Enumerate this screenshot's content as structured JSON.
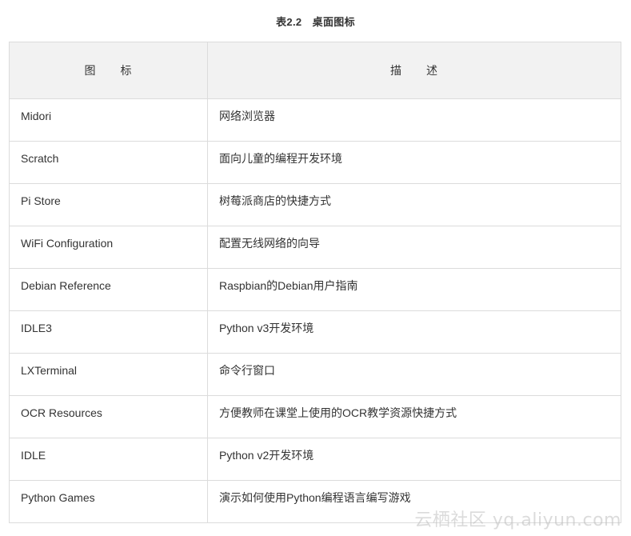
{
  "caption": "表2.2　桌面图标",
  "table": {
    "headers": [
      "图　　标",
      "描　　述"
    ],
    "rows": [
      {
        "icon": "Midori",
        "description": "网络浏览器"
      },
      {
        "icon": "Scratch",
        "description": "面向儿童的编程开发环境"
      },
      {
        "icon": "Pi Store",
        "description": "树莓派商店的快捷方式"
      },
      {
        "icon": "WiFi Configuration",
        "description": "配置无线网络的向导"
      },
      {
        "icon": "Debian Reference",
        "description": "Raspbian的Debian用户指南"
      },
      {
        "icon": "IDLE3",
        "description": "Python v3开发环境"
      },
      {
        "icon": "LXTerminal",
        "description": "命令行窗口"
      },
      {
        "icon": "OCR Resources",
        "description": "方便教师在课堂上使用的OCR教学资源快捷方式"
      },
      {
        "icon": "IDLE",
        "description": "Python v2开发环境"
      },
      {
        "icon": "Python Games",
        "description": "演示如何使用Python编程语言编写游戏"
      }
    ]
  },
  "watermark": "云栖社区 yq.aliyun.com"
}
